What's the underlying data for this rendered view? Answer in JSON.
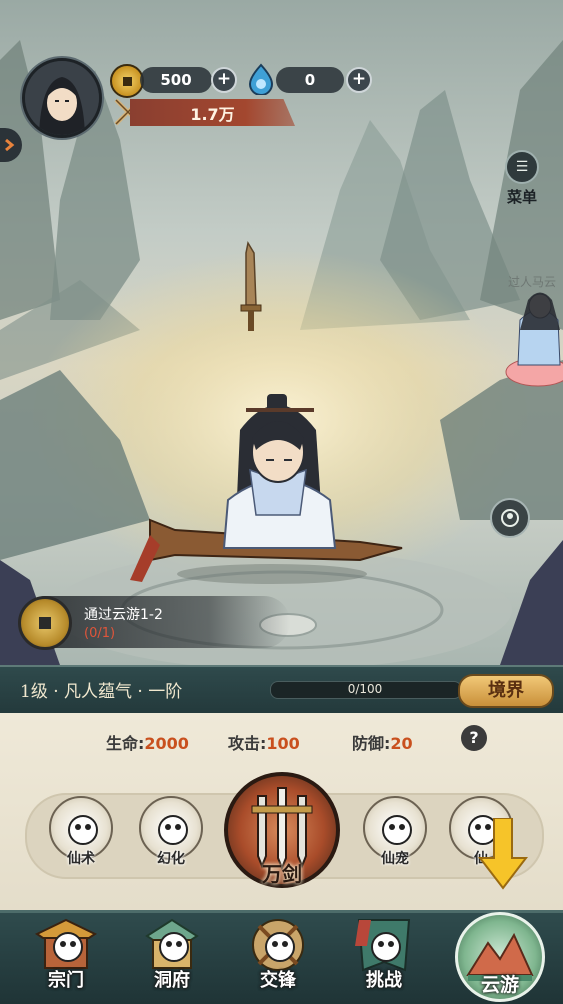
{
  "hud": {
    "gold": "500",
    "spirit_stone": "0",
    "power": "1.7万",
    "menu_label": "菜单",
    "side_label": "过人马云"
  },
  "quest": {
    "title": "通过云游1-2",
    "progress": "(0/1)"
  },
  "level": {
    "text": "1级 · 凡人蕴气 · 一阶",
    "exp": "0/100",
    "exp_fraction": 0,
    "realm_button": "境界"
  },
  "stats": [
    {
      "label": "生命:",
      "value": "2000"
    },
    {
      "label": "攻击:",
      "value": "100"
    },
    {
      "label": "防御:",
      "value": "20"
    }
  ],
  "skills": [
    "仙术",
    "幻化",
    "万剑",
    "仙宠",
    "仙"
  ],
  "nav": [
    "宗门",
    "洞府",
    "交锋",
    "挑战",
    "云游"
  ],
  "colors": {
    "accent": "#c9501e",
    "nav_bg": "#2f4b4d",
    "gold": "#f1c877"
  }
}
